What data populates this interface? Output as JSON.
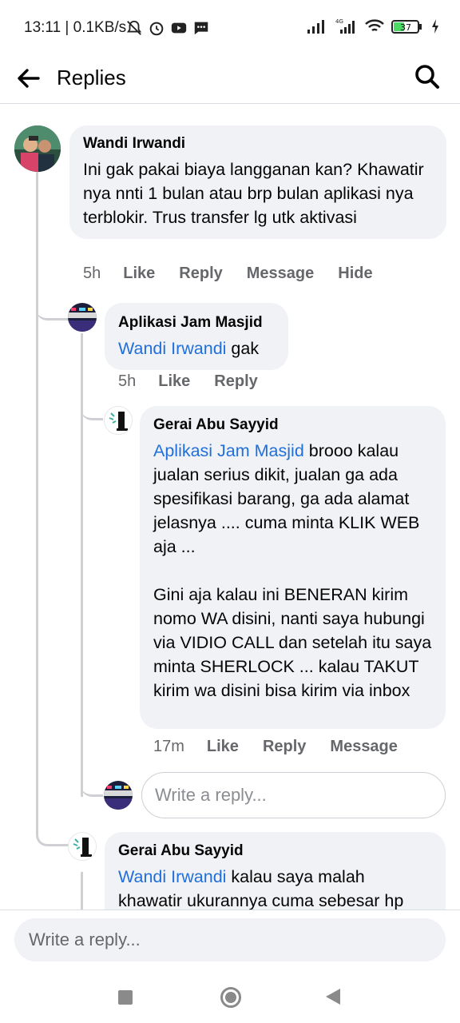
{
  "status": {
    "time_speed": "13:11 | 0.1KB/s",
    "battery": "37",
    "network": "4G"
  },
  "header": {
    "title": "Replies"
  },
  "comments": [
    {
      "author": "Wandi Irwandi",
      "text": "Ini gak pakai biaya langganan kan? Khawatir nya nnti 1 bulan atau brp bulan aplikasi nya terblokir. Trus transfer lg utk aktivasi",
      "time": "5h",
      "actions": [
        "Like",
        "Reply",
        "Message",
        "Hide"
      ]
    },
    {
      "author": "Aplikasi Jam Masjid",
      "mention": "Wandi Irwandi",
      "text": " gak",
      "time": "5h",
      "actions": [
        "Like",
        "Reply"
      ]
    },
    {
      "author": "Gerai Abu Sayyid",
      "mention": "Aplikasi Jam Masjid",
      "text": " brooo kalau jualan serius dikit, jualan ga ada spesifikasi barang, ga ada alamat jelasnya .... cuma minta KLIK WEB aja ...\n\nGini aja kalau ini BENERAN kirim nomo WA disini, nanti saya hubungi via VIDIO CALL dan setelah itu saya minta SHERLOCK ... kalau TAKUT kirim wa disini bisa kirim via inbox",
      "time": "17m",
      "actions": [
        "Like",
        "Reply",
        "Message"
      ]
    },
    {
      "author": "Gerai Abu Sayyid",
      "mention": "Wandi Irwandi",
      "text": " kalau saya malah khawatir ukurannya cuma sebesar hp"
    }
  ],
  "nested_reply_placeholder": "Write a reply...",
  "composer": {
    "placeholder": "Write a reply..."
  },
  "colors": {
    "mention": "#216fdb",
    "bubble": "#f0f2f5",
    "meta": "#65676b"
  }
}
